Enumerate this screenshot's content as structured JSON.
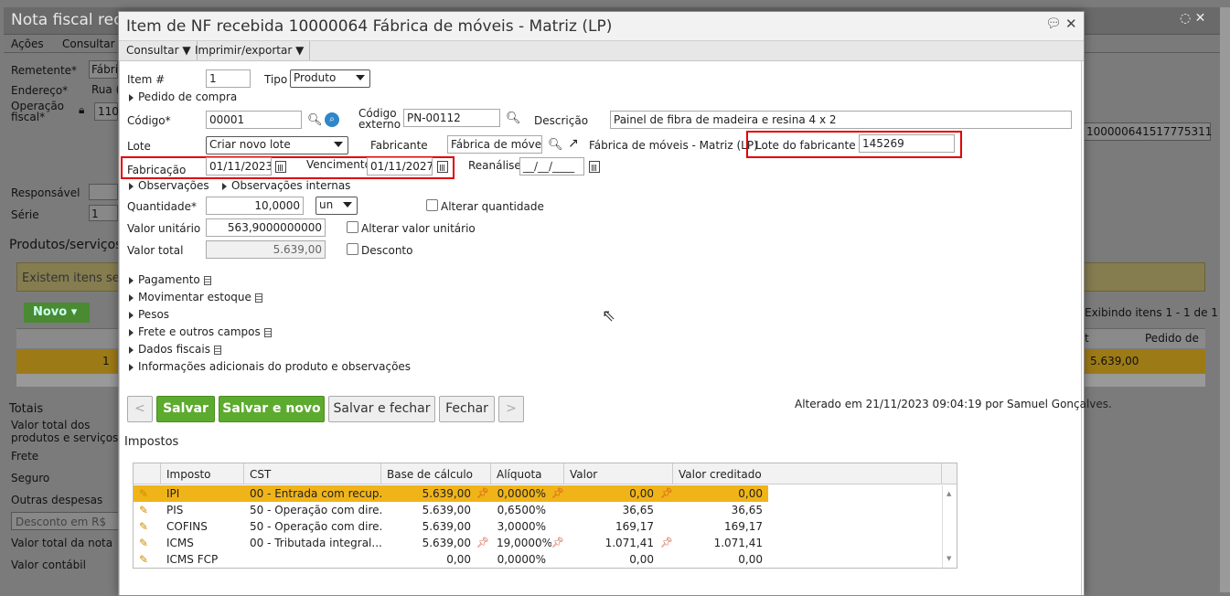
{
  "background": {
    "title": "Nota fiscal rec",
    "menu": [
      "Ações",
      "Consultar"
    ],
    "labels": {
      "remetente": "Remetente*",
      "remetente_value": "Fábri",
      "endereco": "Endereço*",
      "endereco_value": "Rua (",
      "operacao": "Operação fiscal*",
      "operacao_value": "110",
      "responsavel": "Responsável",
      "serie": "Série",
      "serie_value": "1",
      "produtos": "Produtos/serviços",
      "existem": "Existem itens ser",
      "novo": "Novo",
      "row_item": "1",
      "totais": "Totais",
      "valor_total_produtos": "Valor total dos produtos e serviços",
      "frete": "Frete",
      "seguro": "Seguro",
      "outras": "Outras despesas",
      "desconto_rs": "Desconto em R$",
      "valor_total_nota": "Valor total da nota",
      "valor_contabil": "Valor contábil",
      "chave": "100000641517775311",
      "exibindo": "Exibindo itens 1 - 1 de 1",
      "col_t": "t",
      "col_pedido": "Pedido de",
      "row_value": "5.639,00"
    }
  },
  "modal": {
    "title": "Item de NF recebida 10000064 Fábrica de móveis - Matriz (LP)",
    "toolbar": {
      "consultar": "Consultar",
      "imprimir": "Imprimir/exportar"
    },
    "form": {
      "item_label": "Item #",
      "item_value": "1",
      "tipo_label": "Tipo",
      "tipo_value": "Produto",
      "pedido_compra": "Pedido de compra",
      "codigo_label": "Código*",
      "codigo_value": "00001",
      "codigo_externo_label": "Código externo",
      "codigo_externo_value": "PN-00112",
      "descricao_label": "Descrição",
      "descricao_value": "Painel de fibra de madeira e resina 4 x 2",
      "lote_label": "Lote",
      "lote_value": "Criar novo lote",
      "fabricante_label": "Fabricante",
      "fabricante_value": "Fábrica de móveis",
      "fabricante_link": "Fábrica de móveis - Matriz (LP)",
      "lote_fabricante_label": "Lote do fabricante",
      "lote_fabricante_value": "145269",
      "fabricacao_label": "Fabricação",
      "fabricacao_value": "01/11/2023",
      "vencimento_label": "Vencimento",
      "vencimento_value": "01/11/2027",
      "reanalise_label": "Reanálise",
      "reanalise_value": "__/__/____",
      "observacoes": "Observações",
      "observacoes_internas": "Observações internas",
      "quantidade_label": "Quantidade*",
      "quantidade_value": "10,0000",
      "unidade_value": "un",
      "alterar_quantidade": "Alterar quantidade",
      "valor_unitario_label": "Valor unitário",
      "valor_unitario_value": "563,9000000000",
      "alterar_valor_unitario": "Alterar valor unitário",
      "valor_total_label": "Valor total",
      "valor_total_value": "5.639,00",
      "desconto": "Desconto"
    },
    "sections": [
      "Pagamento",
      "Movimentar estoque",
      "Pesos",
      "Frete e outros campos",
      "Dados fiscais",
      "Informações adicionais do produto e observações"
    ],
    "buttons": {
      "prev": "<",
      "salvar": "Salvar",
      "salvar_novo": "Salvar e novo",
      "salvar_fechar": "Salvar e fechar",
      "fechar": "Fechar",
      "next": ">"
    },
    "altered": "Alterado em 21/11/2023 09:04:19 por Samuel Gonçalves.",
    "impostos": {
      "title": "Impostos",
      "headers": [
        "Imposto",
        "CST",
        "Base de cálculo",
        "Alíquota",
        "Valor",
        "Valor creditado"
      ],
      "rows": [
        {
          "imposto": "IPI",
          "cst": "00 - Entrada com recup...",
          "base": "5.639,00",
          "aliquota": "0,0000%",
          "valor": "0,00",
          "creditado": "0,00"
        },
        {
          "imposto": "PIS",
          "cst": "50 - Operação com dire...",
          "base": "5.639,00",
          "aliquota": "0,6500%",
          "valor": "36,65",
          "creditado": "36,65"
        },
        {
          "imposto": "COFINS",
          "cst": "50 - Operação com dire...",
          "base": "5.639,00",
          "aliquota": "3,0000%",
          "valor": "169,17",
          "creditado": "169,17"
        },
        {
          "imposto": "ICMS",
          "cst": "00 - Tributada integral...",
          "base": "5.639,00",
          "aliquota": "19,0000%",
          "valor": "1.071,41",
          "creditado": "1.071,41"
        },
        {
          "imposto": "ICMS FCP",
          "cst": "",
          "base": "0,00",
          "aliquota": "0,0000%",
          "valor": "0,00",
          "creditado": "0,00"
        }
      ]
    }
  },
  "colors": {
    "green": "#5cab2e",
    "highlight": "#f0b419",
    "red_box": "#e00000"
  }
}
